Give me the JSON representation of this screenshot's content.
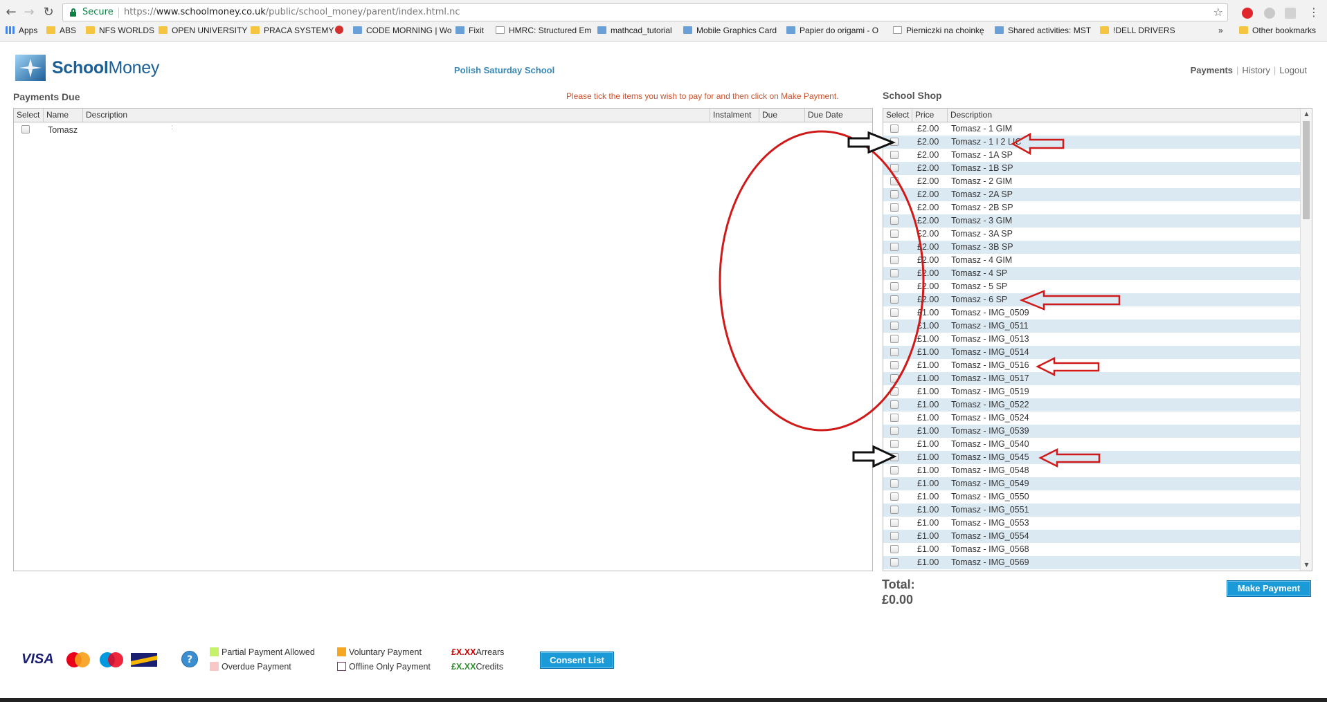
{
  "browser": {
    "secure_label": "Secure",
    "url_prefix": "https://",
    "url_host": "www.schoolmoney.co.uk",
    "url_path": "/public/school_money/parent/index.html.nc",
    "bookmarks": [
      {
        "label": "Apps",
        "icon": "apps-grid-icon"
      },
      {
        "label": "ABS",
        "icon": "folder-icon"
      },
      {
        "label": "NFS WORLDS",
        "icon": "folder-icon"
      },
      {
        "label": "OPEN UNIVERSITY",
        "icon": "folder-icon"
      },
      {
        "label": "PRACA SYSTEMY",
        "icon": "folder-icon"
      },
      {
        "label": "",
        "icon": "no-entry-icon"
      },
      {
        "label": "CODE MORNING | Wo",
        "icon": "site-icon"
      },
      {
        "label": "Fixit",
        "icon": "site-icon"
      },
      {
        "label": "HMRC: Structured Em",
        "icon": "page-icon"
      },
      {
        "label": "mathcad_tutorial",
        "icon": "site-icon"
      },
      {
        "label": "Mobile Graphics Card",
        "icon": "site-icon"
      },
      {
        "label": "Papier do origami - O",
        "icon": "site-icon"
      },
      {
        "label": "Pierniczki na choinkę",
        "icon": "page-icon"
      },
      {
        "label": "Shared activities: MST",
        "icon": "site-icon"
      },
      {
        "label": "!DELL DRIVERS",
        "icon": "folder-icon"
      }
    ],
    "overflow": "»",
    "other_bookmarks": "Other bookmarks"
  },
  "header": {
    "logo_bold": "School",
    "logo_rest": "Money",
    "school_name": "Polish Saturday School",
    "nav": [
      "Payments",
      "History",
      "Logout"
    ]
  },
  "payments_due": {
    "title": "Payments Due",
    "instruction": "Please tick the items you wish to pay for and then click on Make Payment.",
    "columns": [
      "Select",
      "Name",
      "Description",
      "Instalment",
      "Due",
      "Due Date"
    ],
    "rows": [
      {
        "name": "Tomasz",
        "description": ":"
      }
    ]
  },
  "shop": {
    "title": "School Shop",
    "columns": [
      "Select",
      "Price",
      "Description"
    ],
    "items": [
      {
        "price": "£2.00",
        "description": "Tomasz - 1 GIM"
      },
      {
        "price": "£2.00",
        "description": "Tomasz - 1 I 2 LIC"
      },
      {
        "price": "£2.00",
        "description": "Tomasz - 1A SP"
      },
      {
        "price": "£2.00",
        "description": "Tomasz - 1B SP"
      },
      {
        "price": "£2.00",
        "description": "Tomasz - 2 GIM"
      },
      {
        "price": "£2.00",
        "description": "Tomasz - 2A SP"
      },
      {
        "price": "£2.00",
        "description": "Tomasz - 2B SP"
      },
      {
        "price": "£2.00",
        "description": "Tomasz - 3 GIM"
      },
      {
        "price": "£2.00",
        "description": "Tomasz - 3A SP"
      },
      {
        "price": "£2.00",
        "description": "Tomasz - 3B SP"
      },
      {
        "price": "£2.00",
        "description": "Tomasz - 4 GIM"
      },
      {
        "price": "£2.00",
        "description": "Tomasz - 4 SP"
      },
      {
        "price": "£2.00",
        "description": "Tomasz - 5 SP"
      },
      {
        "price": "£2.00",
        "description": "Tomasz - 6 SP"
      },
      {
        "price": "£1.00",
        "description": "Tomasz - IMG_0509"
      },
      {
        "price": "£1.00",
        "description": "Tomasz - IMG_0511"
      },
      {
        "price": "£1.00",
        "description": "Tomasz - IMG_0513"
      },
      {
        "price": "£1.00",
        "description": "Tomasz - IMG_0514"
      },
      {
        "price": "£1.00",
        "description": "Tomasz - IMG_0516"
      },
      {
        "price": "£1.00",
        "description": "Tomasz - IMG_0517"
      },
      {
        "price": "£1.00",
        "description": "Tomasz - IMG_0519"
      },
      {
        "price": "£1.00",
        "description": "Tomasz - IMG_0522"
      },
      {
        "price": "£1.00",
        "description": "Tomasz - IMG_0524"
      },
      {
        "price": "£1.00",
        "description": "Tomasz - IMG_0539"
      },
      {
        "price": "£1.00",
        "description": "Tomasz - IMG_0540"
      },
      {
        "price": "£1.00",
        "description": "Tomasz - IMG_0545"
      },
      {
        "price": "£1.00",
        "description": "Tomasz - IMG_0548"
      },
      {
        "price": "£1.00",
        "description": "Tomasz - IMG_0549"
      },
      {
        "price": "£1.00",
        "description": "Tomasz - IMG_0550"
      },
      {
        "price": "£1.00",
        "description": "Tomasz - IMG_0551"
      },
      {
        "price": "£1.00",
        "description": "Tomasz - IMG_0553"
      },
      {
        "price": "£1.00",
        "description": "Tomasz - IMG_0554"
      },
      {
        "price": "£1.00",
        "description": "Tomasz - IMG_0568"
      },
      {
        "price": "£1.00",
        "description": "Tomasz - IMG_0569"
      }
    ],
    "total_label": "Total:",
    "total_value": "£0.00",
    "make_payment": "Make Payment"
  },
  "footer": {
    "cards": [
      "VISA",
      "MasterCard",
      "Maestro",
      "DELTA"
    ],
    "help": "?",
    "legend": {
      "partial": "Partial Payment Allowed",
      "overdue": "Overdue Payment",
      "voluntary": "Voluntary Payment",
      "offline": "Offline Only Payment",
      "arrears_amount": "£X.XX",
      "arrears_label": "Arrears",
      "credits_amount": "£X.XX",
      "credits_label": "Credits"
    },
    "consent_list": "Consent List"
  },
  "colors": {
    "accent": "#1a9ad7",
    "row_alt": "#dbe9f3",
    "instruction": "#c8532d",
    "partial": "#c6f26a",
    "overdue": "#f8c8c8",
    "voluntary": "#f5a623",
    "arrears": "#cc0000",
    "credits": "#2e8b2e",
    "annotation_red": "#d01a1a"
  }
}
